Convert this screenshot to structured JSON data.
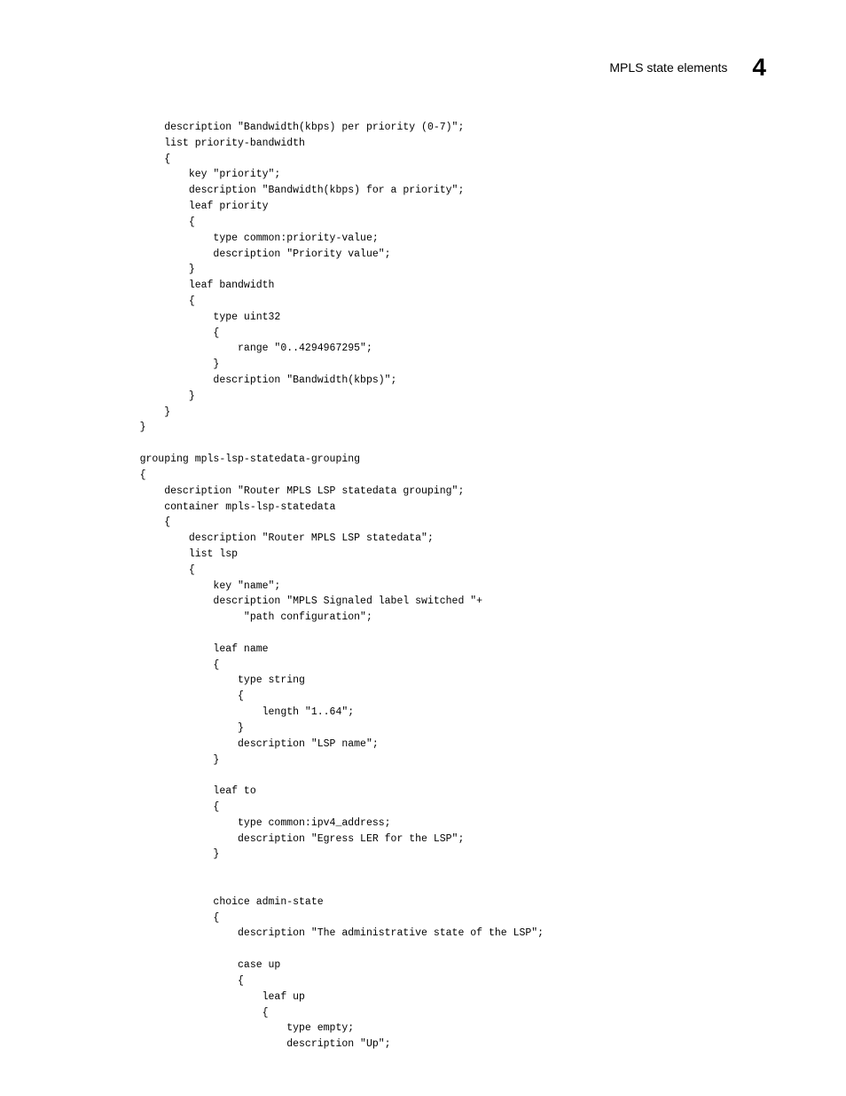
{
  "header": {
    "section": "MPLS state elements",
    "chapter": "4"
  },
  "code": "        description \"Bandwidth(kbps) per priority (0-7)\";\n        list priority-bandwidth\n        {\n            key \"priority\";\n            description \"Bandwidth(kbps) for a priority\";\n            leaf priority\n            {\n                type common:priority-value;\n                description \"Priority value\";\n            }\n            leaf bandwidth\n            {\n                type uint32\n                {\n                    range \"0..4294967295\";\n                }\n                description \"Bandwidth(kbps)\";\n            }\n        }\n    }\n\n    grouping mpls-lsp-statedata-grouping\n    {\n        description \"Router MPLS LSP statedata grouping\";\n        container mpls-lsp-statedata\n        {\n            description \"Router MPLS LSP statedata\";\n            list lsp\n            {\n                key \"name\";\n                description \"MPLS Signaled label switched \"+\n                     \"path configuration\";\n\n                leaf name\n                {\n                    type string\n                    {\n                        length \"1..64\";\n                    }\n                    description \"LSP name\";\n                }\n\n                leaf to\n                {\n                    type common:ipv4_address;\n                    description \"Egress LER for the LSP\";\n                }\n\n\n                choice admin-state\n                {\n                    description \"The administrative state of the LSP\";\n\n                    case up\n                    {\n                        leaf up\n                        {\n                            type empty;\n                            description \"Up\";"
}
